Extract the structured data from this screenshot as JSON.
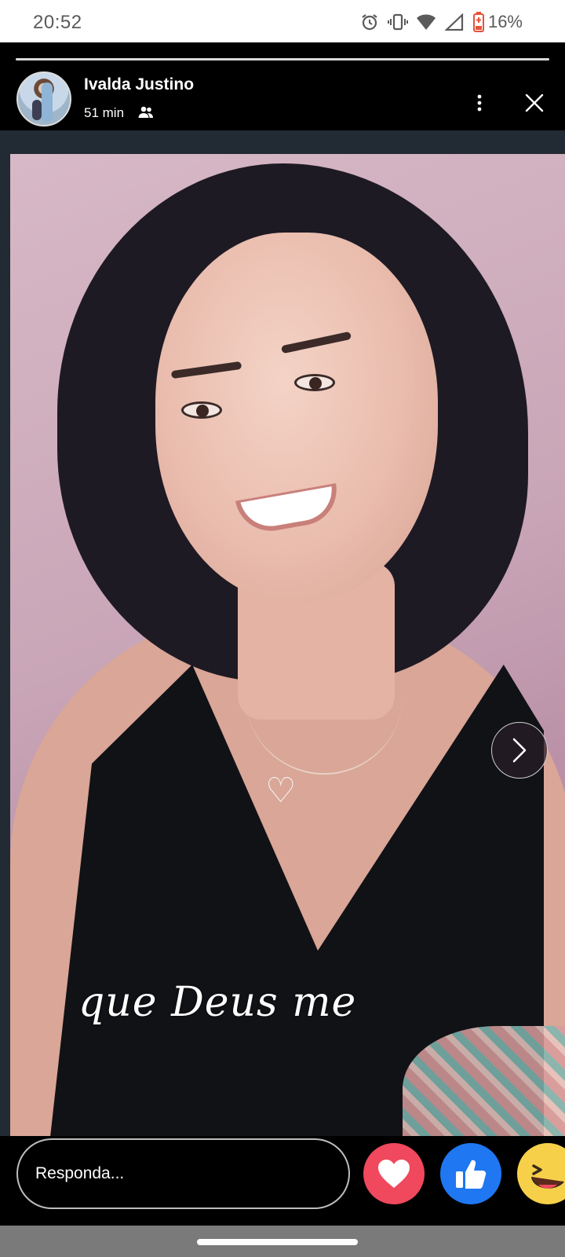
{
  "status_bar": {
    "time": "20:52",
    "battery_percent": "16%",
    "icons": [
      "alarm-icon",
      "vibrate-icon",
      "wifi-icon",
      "signal-icon",
      "battery-low-icon"
    ]
  },
  "story": {
    "progress": 1.0,
    "user_name": "Ivalda Justino",
    "time_ago": "51 min",
    "audience_icon": "friends-icon",
    "caption": "que Deus me"
  },
  "reply": {
    "placeholder": "Responda..."
  },
  "reactions": [
    {
      "name": "love",
      "color": "#f0485d"
    },
    {
      "name": "like",
      "color": "#1f77f2"
    },
    {
      "name": "haha",
      "color": "#f7d04a"
    }
  ]
}
